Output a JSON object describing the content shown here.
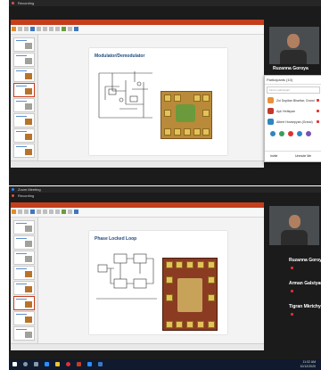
{
  "window1": {
    "title": "Recording",
    "slide": {
      "title": "Modulator/Demodulator"
    },
    "participants_panel": {
      "title": "Participants (10)",
      "search_placeholder": "Find a participant",
      "rows": [
        {
          "name": "Zoi Dupitan Bharitar, Grand",
          "avatar_color": "#e8913a"
        },
        {
          "name": "Ayk Yeritsyan",
          "avatar_color": "#c0392b"
        },
        {
          "name": "Albert Hovsepyan (Grand)",
          "avatar_color": "#2e86c1"
        }
      ],
      "footer": [
        "Invite",
        "Unmute Me"
      ]
    },
    "speaker_name": "Ruzanna Goroya"
  },
  "window2": {
    "title": "Zoom Meeting",
    "subtitle": "Recording",
    "slide": {
      "title": "Phase Locked Loop"
    },
    "participants": [
      {
        "name": "Ruzanna Goroya"
      },
      {
        "name": "Arman Galstyan"
      },
      {
        "name": "Tigran Mkrtchya"
      }
    ]
  },
  "taskbar": {
    "clock_time": "11:02 AM",
    "clock_date": "10/12/2020"
  },
  "colors": {
    "ppt_accent": "#c43e1c",
    "zoom_dark": "#1b1b1b",
    "taskbar": "#0f1a2e",
    "mute_red": "#e03131"
  }
}
